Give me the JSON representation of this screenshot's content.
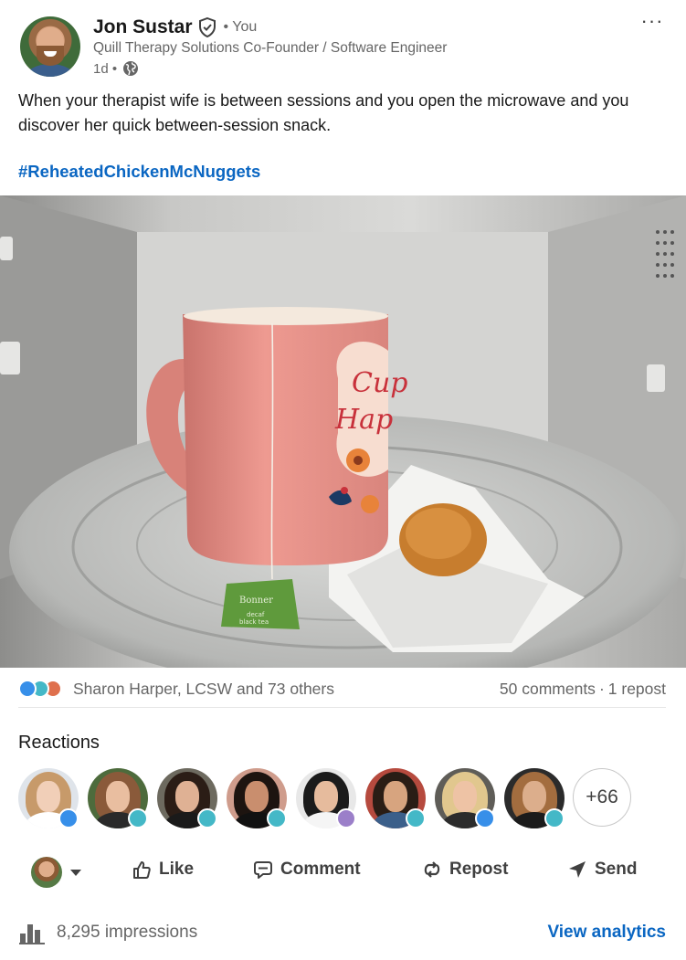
{
  "post": {
    "author": {
      "name": "Jon Sustar",
      "relation": "• You",
      "headline": "Quill Therapy Solutions Co-Founder / Software Engineer",
      "time": "1d •",
      "verified_icon": "verified-shield-icon",
      "visibility_icon": "globe-icon"
    },
    "more_label": "···",
    "text": "When your therapist wife is between sessions and you open the microwave and you discover her quick between-session snack.",
    "hashtag": "#ReheatedChickenMcNuggets",
    "image": {
      "mug_text_line1": "Cup",
      "mug_text_line2": "Hap",
      "tea_tag_brand": "Bonner",
      "tea_tag_line1": "decaf",
      "tea_tag_line2": "black tea"
    }
  },
  "social": {
    "reaction_icons": [
      "like-icon",
      "funny-icon",
      "love-icon"
    ],
    "reactors_text": "Sharon Harper, LCSW and 73 others",
    "comments": "50 comments",
    "separator": "·",
    "reposts": "1 repost"
  },
  "reactions": {
    "title": "Reactions",
    "people": [
      {
        "reaction": "like"
      },
      {
        "reaction": "funny"
      },
      {
        "reaction": "funny"
      },
      {
        "reaction": "funny"
      },
      {
        "reaction": "love"
      },
      {
        "reaction": "funny"
      },
      {
        "reaction": "like"
      },
      {
        "reaction": "funny"
      }
    ],
    "more": "+66"
  },
  "actions": {
    "like": "Like",
    "comment": "Comment",
    "repost": "Repost",
    "send": "Send"
  },
  "footer": {
    "impressions": "8,295 impressions",
    "analytics": "View analytics"
  },
  "colors": {
    "link": "#0a66c2",
    "like": "#378fe9",
    "funny": "#44b8c7",
    "love": "#df704d"
  }
}
